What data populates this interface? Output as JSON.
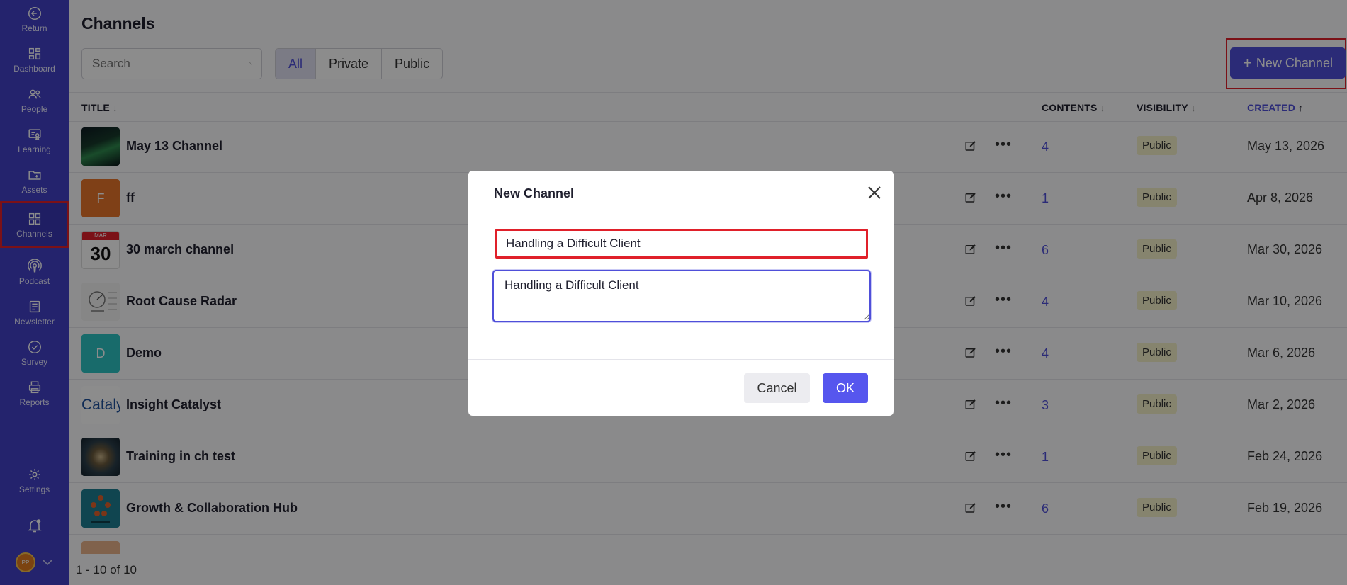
{
  "sidebar": {
    "items": [
      {
        "label": "Return",
        "icon": "return-icon"
      },
      {
        "label": "Dashboard",
        "icon": "dashboard-icon"
      },
      {
        "label": "People",
        "icon": "people-icon"
      },
      {
        "label": "Learning",
        "icon": "learning-icon"
      },
      {
        "label": "Assets",
        "icon": "assets-icon"
      },
      {
        "label": "Channels",
        "icon": "channels-icon",
        "active": true
      },
      {
        "label": "Podcast",
        "icon": "podcast-icon"
      },
      {
        "label": "Newsletter",
        "icon": "newsletter-icon"
      },
      {
        "label": "Survey",
        "icon": "survey-icon"
      },
      {
        "label": "Reports",
        "icon": "reports-icon"
      },
      {
        "label": "Settings",
        "icon": "settings-icon"
      }
    ],
    "avatar_initials": "PP"
  },
  "header": {
    "title": "Channels",
    "search_placeholder": "Search",
    "filters": [
      "All",
      "Private",
      "Public"
    ],
    "active_filter": "All",
    "new_channel_label": "New Channel"
  },
  "table": {
    "columns": {
      "title": "TITLE",
      "contents": "CONTENTS",
      "visibility": "VISIBILITY",
      "created": "CREATED"
    },
    "rows": [
      {
        "title": "May 13 Channel",
        "contents": "4",
        "visibility": "Public",
        "created": "May 13, 2026",
        "thumb": "image"
      },
      {
        "title": "ff",
        "contents": "1",
        "visibility": "Public",
        "created": "Apr 8, 2026",
        "thumb_letter": "F"
      },
      {
        "title": "30 march channel",
        "contents": "6",
        "visibility": "Public",
        "created": "Mar 30, 2026",
        "thumb_month": "MAR",
        "thumb_day": "30"
      },
      {
        "title": "Root Cause Radar",
        "contents": "4",
        "visibility": "Public",
        "created": "Mar 10, 2026",
        "thumb": "image"
      },
      {
        "title": "Demo",
        "contents": "4",
        "visibility": "Public",
        "created": "Mar 6, 2026",
        "thumb_letter": "D"
      },
      {
        "title": "Insight Catalyst",
        "contents": "3",
        "visibility": "Public",
        "created": "Mar 2, 2026",
        "thumb_text": "Cataly"
      },
      {
        "title": "Training in ch test",
        "contents": "1",
        "visibility": "Public",
        "created": "Feb 24, 2026",
        "thumb": "image"
      },
      {
        "title": "Growth & Collaboration Hub",
        "contents": "6",
        "visibility": "Public",
        "created": "Feb 19, 2026",
        "thumb": "image"
      }
    ],
    "pagination": "1 - 10 of 10"
  },
  "modal": {
    "title": "New Channel",
    "name_value": "Handling a Difficult Client",
    "description_value": "Handling a Difficult Client",
    "cancel_label": "Cancel",
    "ok_label": "OK"
  },
  "colors": {
    "sidebar": "#4341c6",
    "accent": "#4f4fd9",
    "ok_button": "#5656ee",
    "highlight": "#e0202a",
    "badge": "#f4f0c8"
  }
}
